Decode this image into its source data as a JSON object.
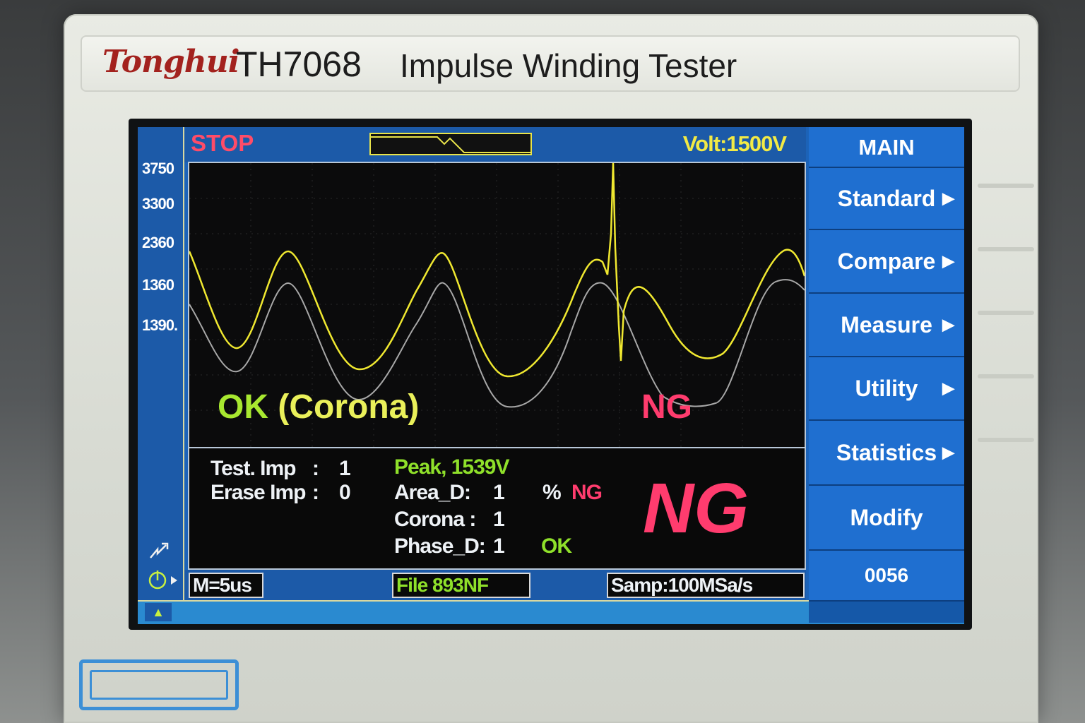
{
  "device": {
    "brand": "Tonghui",
    "model": "TH7068",
    "product": "Impulse Winding Tester"
  },
  "status": {
    "state": "STOP",
    "voltage": "Volt:1500V"
  },
  "y_axis_labels": [
    "3750",
    "3300",
    "2360",
    "1360",
    "1390."
  ],
  "plot_labels": {
    "ok": "OK",
    "corona": "(Corona)",
    "ng": "NG"
  },
  "results": {
    "test_imp_label": "Test. Imp",
    "test_imp_sep": ":",
    "test_imp_value": "1",
    "erase_imp_label": "Erase Imp",
    "erase_imp_sep": ":",
    "erase_imp_value": "0",
    "peak": "Peak, 1539V",
    "area_label": "Area_D:",
    "area_value": "1",
    "area_unit": "%",
    "area_status": "NG",
    "corona_label": "Corona :",
    "corona_value": "1",
    "phase_label": "Phase_D:",
    "phase_value": "1",
    "phase_status": "OK",
    "overall": "NG"
  },
  "bottom_bar": {
    "timebase": "M=5us",
    "file": "File 893NF",
    "sampling": "Samp:100MSa/s"
  },
  "menu": {
    "title": "MAIN",
    "items": [
      "Standard",
      "Compare",
      "Measure",
      "Utility",
      "Statistics",
      "Modify"
    ],
    "counter": "0056"
  },
  "icons": {
    "strip_top": "hand-pointer-icon",
    "strip_power": "power-icon",
    "corner": "usb-icon",
    "menu_arrow": "triangle-right-icon"
  },
  "colors": {
    "screen_blue": "#1c63b8",
    "wave_yellow": "#f0e830",
    "wave_gray": "#a8a8a8",
    "ng_red": "#ff3c6e",
    "ok_green": "#8fe02a"
  }
}
